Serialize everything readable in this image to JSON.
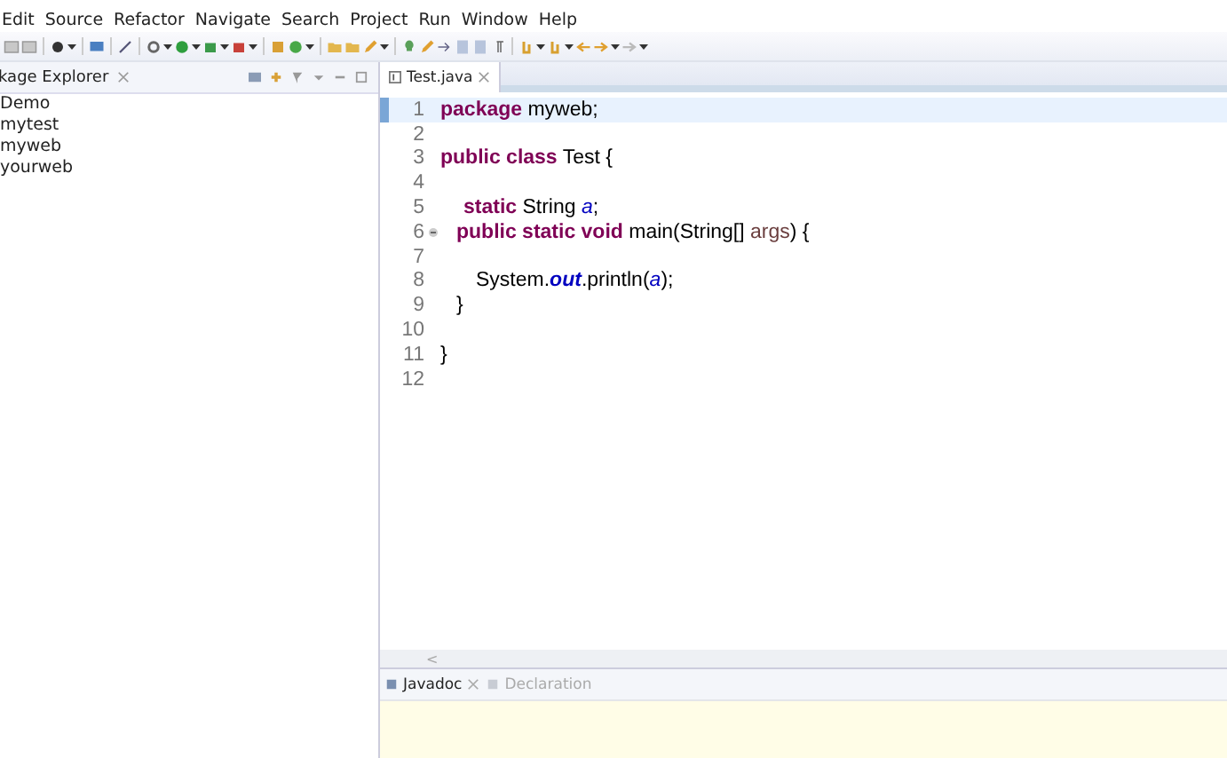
{
  "menu_bar": {
    "items": [
      "Edit",
      "Source",
      "Refactor",
      "Navigate",
      "Search",
      "Project",
      "Run",
      "Window",
      "Help"
    ]
  },
  "package_explorer": {
    "title": "kage Explorer",
    "projects": [
      "Demo",
      "mytest",
      "myweb",
      "yourweb"
    ]
  },
  "editor": {
    "tabs": [
      {
        "label": "Test.java",
        "selected": true
      }
    ],
    "lines": [
      {
        "number": "1",
        "current": true,
        "kind": "top",
        "tokens": [
          {
            "kind": "keyword",
            "text": "package"
          },
          {
            "kind": "plain",
            "text": " myweb;"
          }
        ]
      },
      {
        "number": "2",
        "current": false
      },
      {
        "number": "3",
        "current": false,
        "kind": "top",
        "tokens": [
          {
            "kind": "keyword",
            "text": "public class"
          },
          {
            "kind": "plain",
            "text": " Test {"
          }
        ]
      },
      {
        "number": "4",
        "current": false
      },
      {
        "number": "5",
        "current": false,
        "kind": "field",
        "tokens": [
          {
            "kind": "keyword",
            "text": "static"
          },
          {
            "kind": "plain",
            "text": " String "
          },
          {
            "kind": "field",
            "text": "a"
          },
          {
            "kind": "plain",
            "text": ";"
          }
        ]
      },
      {
        "number": "6",
        "current": false,
        "kind": "member",
        "foldable": true,
        "tokens": [
          {
            "kind": "keyword",
            "text": "public static void"
          },
          {
            "kind": "plain",
            "text": " main(String[] "
          },
          {
            "kind": "param",
            "text": "args"
          },
          {
            "kind": "plain",
            "text": ") {"
          }
        ]
      },
      {
        "number": "7",
        "current": false
      },
      {
        "number": "8",
        "current": false,
        "kind": "body",
        "tokens": [
          {
            "kind": "plain",
            "text": "System."
          },
          {
            "kind": "static-field",
            "text": "out"
          },
          {
            "kind": "plain",
            "text": ".println("
          },
          {
            "kind": "field",
            "text": "a"
          },
          {
            "kind": "plain",
            "text": ");"
          }
        ]
      },
      {
        "number": "9",
        "current": false,
        "kind": "member",
        "tokens": [
          {
            "kind": "plain",
            "text": "}"
          }
        ]
      },
      {
        "number": "10",
        "current": false
      },
      {
        "number": "11",
        "current": false,
        "kind": "top",
        "tokens": [
          {
            "kind": "plain",
            "text": "}"
          }
        ]
      },
      {
        "number": "12",
        "current": false
      }
    ],
    "scroll_arrow": "<"
  },
  "bottom_panel": {
    "tabs": [
      {
        "label": "Javadoc",
        "selected": true
      },
      {
        "label": "Declaration",
        "selected": false
      }
    ]
  }
}
